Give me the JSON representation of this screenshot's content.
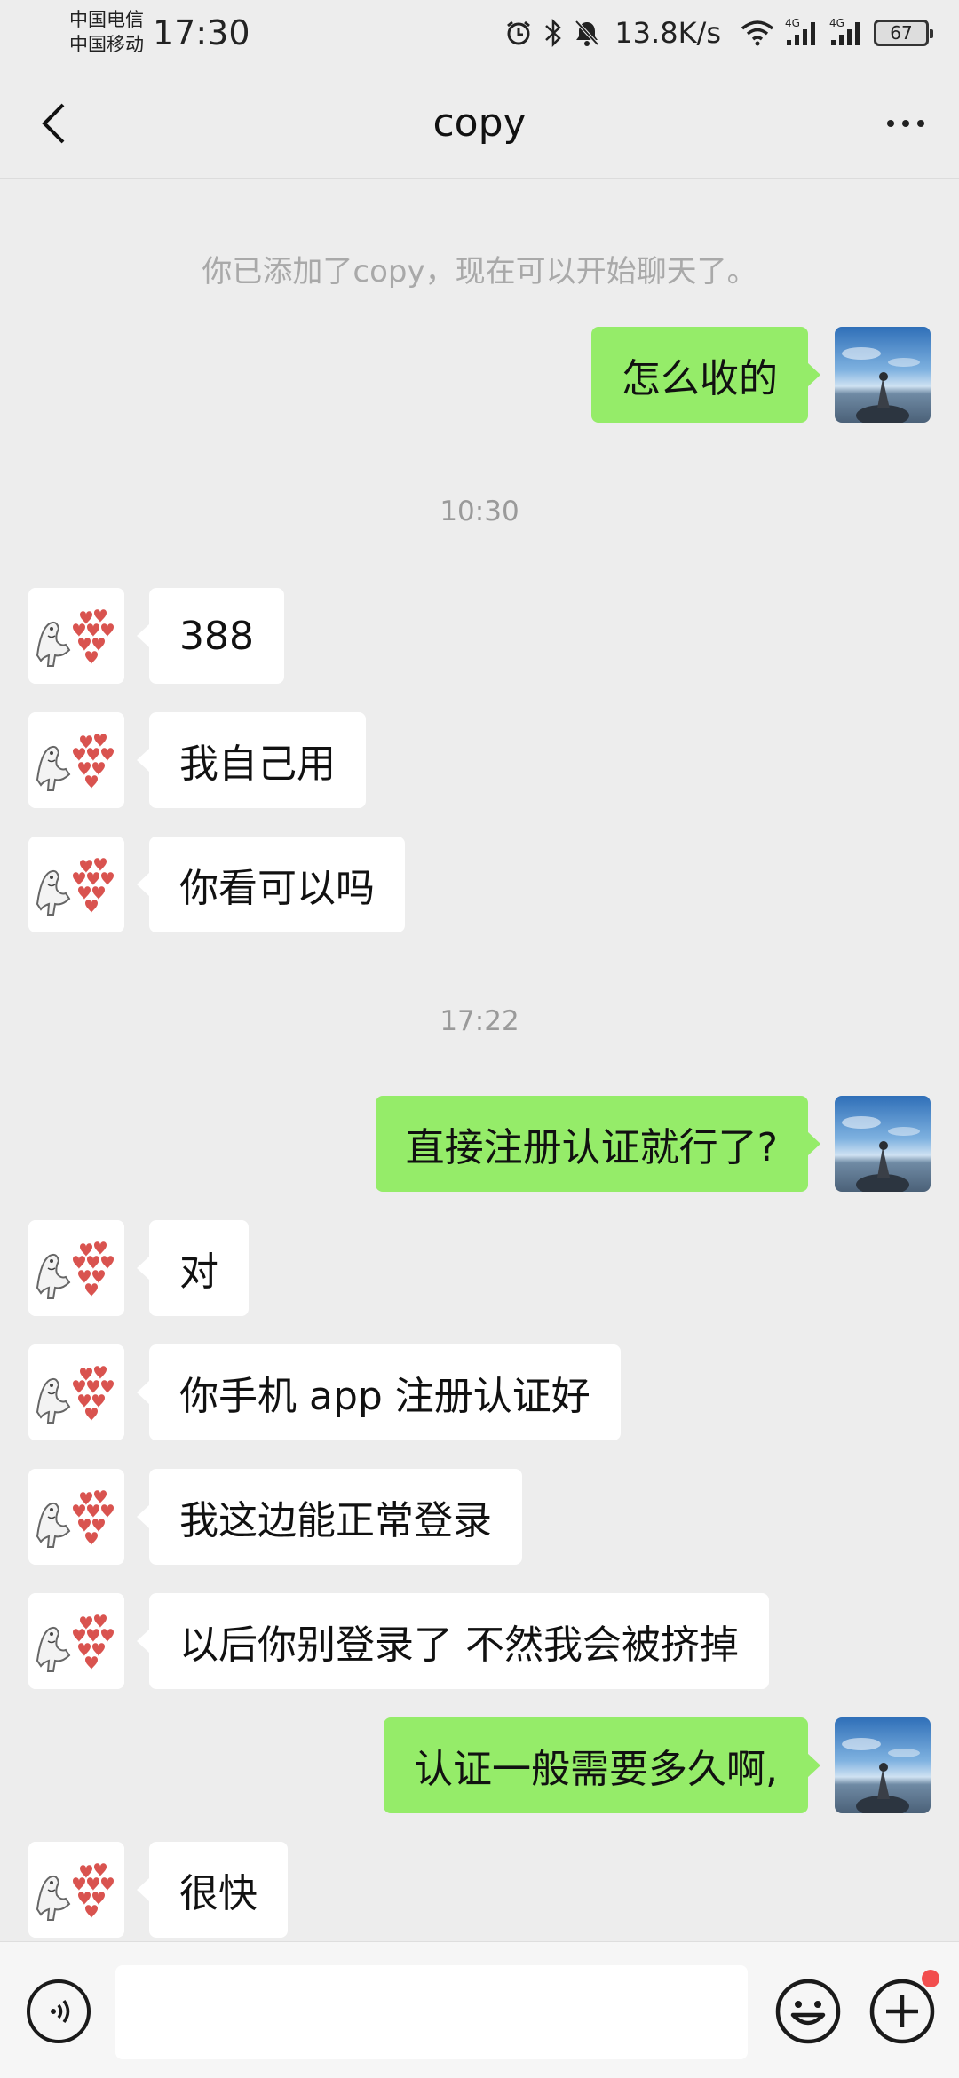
{
  "status_bar": {
    "carrier_1": "中国电信",
    "carrier_2": "中国移动",
    "time": "17:30",
    "net_speed": "13.8K/s",
    "signal_1_label": "4G",
    "signal_2_label": "4G",
    "battery": "67",
    "icons": [
      "alarm-icon",
      "bluetooth-icon",
      "mute-icon",
      "wifi-icon",
      "signal-icon",
      "battery-icon"
    ]
  },
  "header": {
    "title": "copy"
  },
  "chat": {
    "system_note": "你已添加了copy，现在可以开始聊天了。",
    "messages": [
      {
        "sender": "self",
        "text": "怎么收的"
      },
      {
        "type": "time",
        "text": "10:30"
      },
      {
        "sender": "other",
        "text": "388"
      },
      {
        "sender": "other",
        "text": "我自己用"
      },
      {
        "sender": "other",
        "text": "你看可以吗"
      },
      {
        "type": "time",
        "text": "17:22"
      },
      {
        "sender": "self",
        "text": "直接注册认证就行了?"
      },
      {
        "sender": "other",
        "text": "对"
      },
      {
        "sender": "other",
        "text": "你手机 app 注册认证好"
      },
      {
        "sender": "other",
        "text": "我这边能正常登录"
      },
      {
        "sender": "other",
        "text": "以后你别登录了 不然我会被挤掉"
      },
      {
        "sender": "self",
        "text": "认证一般需要多久啊,"
      },
      {
        "sender": "other",
        "text": "很快"
      }
    ]
  },
  "input_bar": {
    "value": "",
    "icons": [
      "voice-icon",
      "emoji-icon",
      "plus-icon"
    ]
  },
  "colors": {
    "background": "#ededed",
    "self_bubble": "#95ec69",
    "other_bubble": "#ffffff",
    "badge": "#f24e4e"
  }
}
